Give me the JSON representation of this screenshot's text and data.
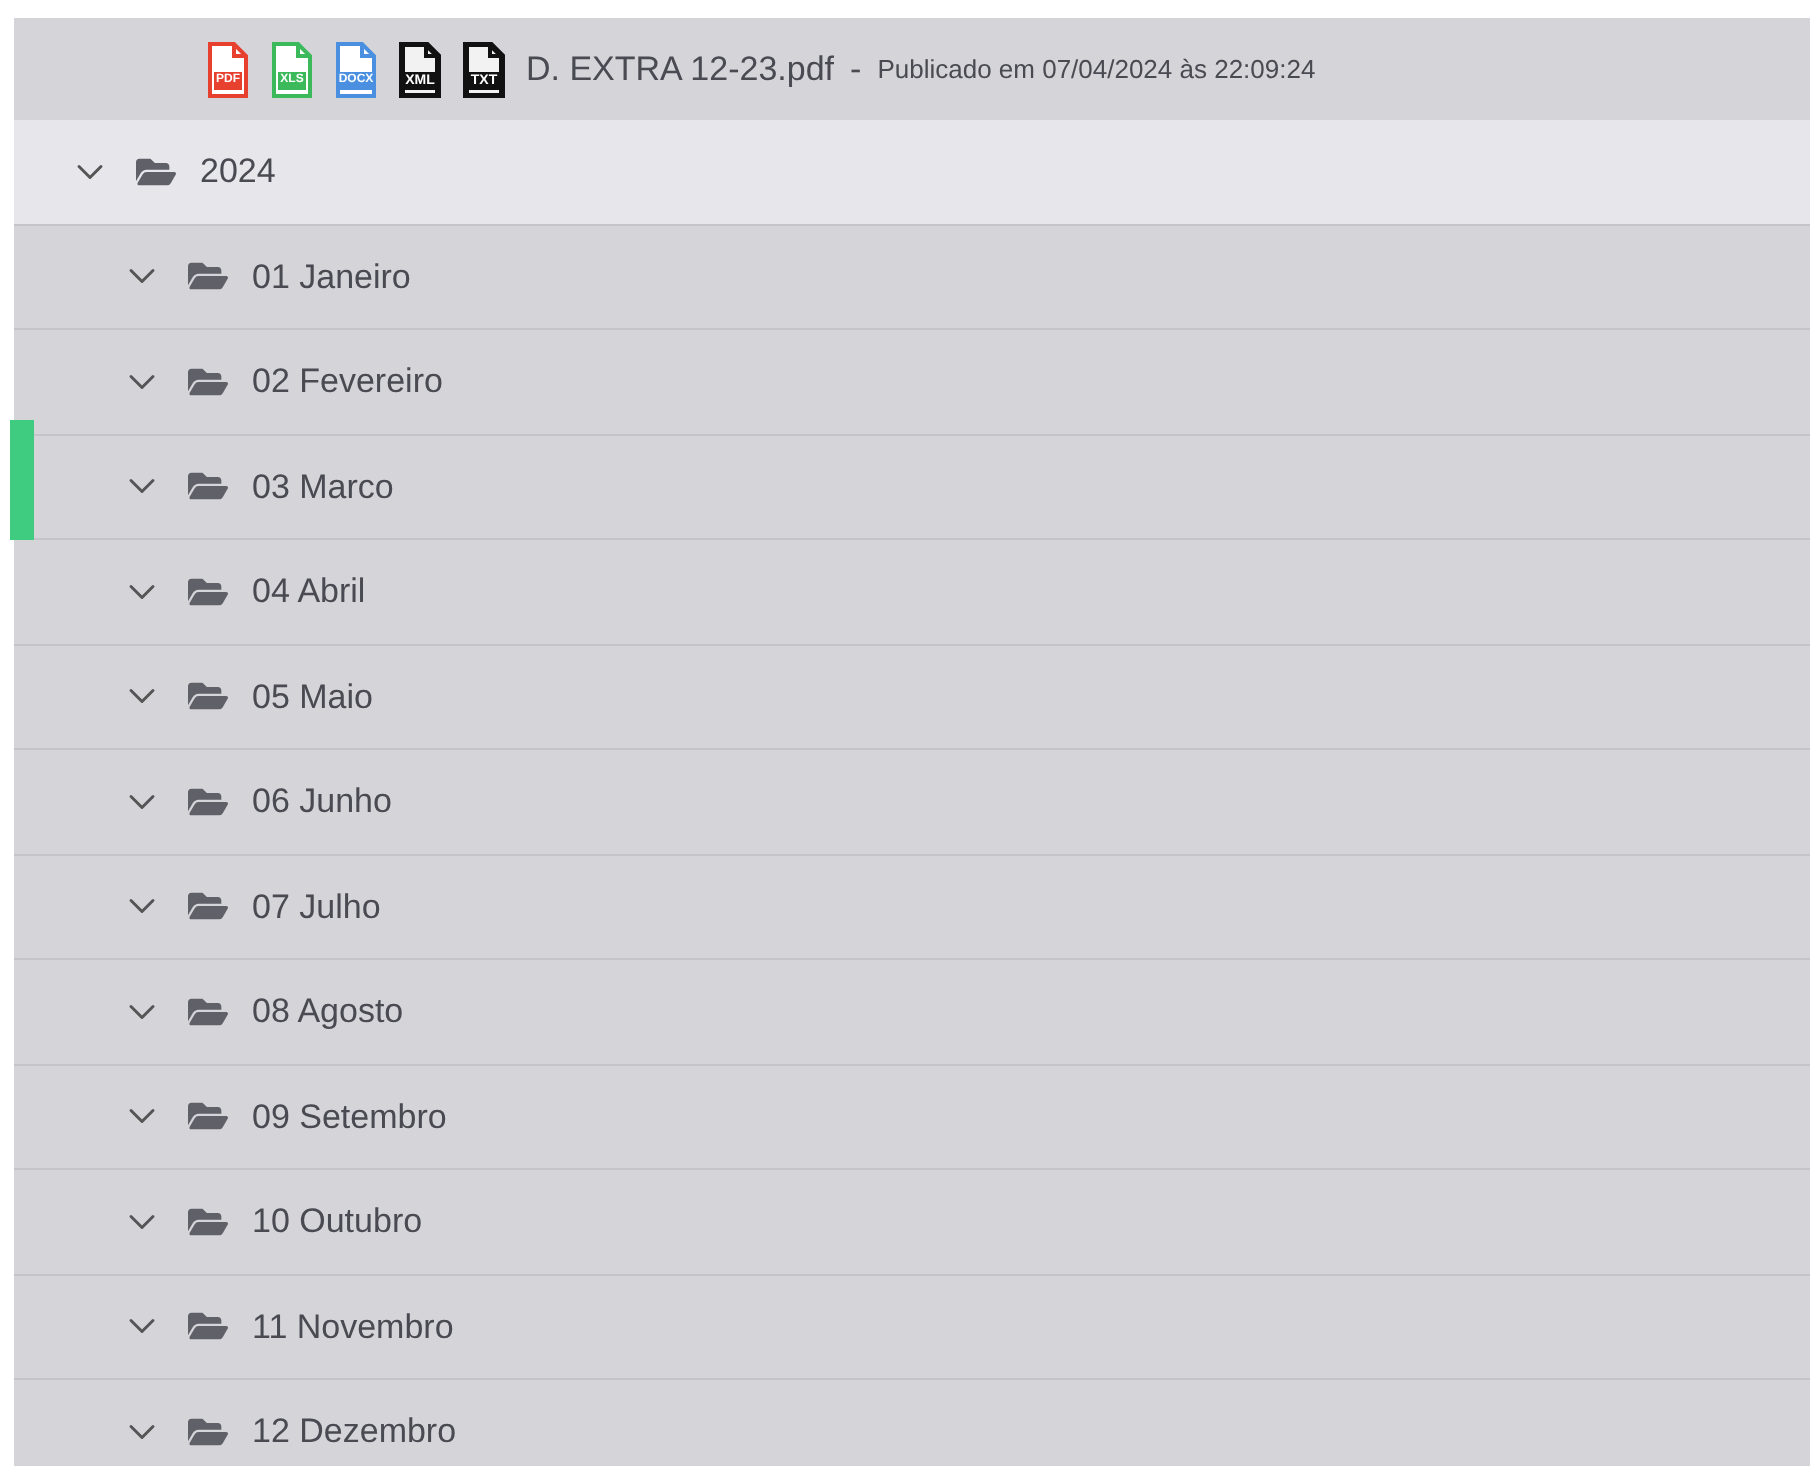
{
  "document": {
    "files": [
      {
        "label": "PDF",
        "color": "#e8402f",
        "kind": "outline"
      },
      {
        "label": "XLS",
        "color": "#3cb95a",
        "kind": "outline"
      },
      {
        "label": "DOCX",
        "color": "#4a8fe0",
        "kind": "outline"
      },
      {
        "label": "XML",
        "color": "#111111",
        "kind": "solid"
      },
      {
        "label": "TXT",
        "color": "#111111",
        "kind": "solid"
      }
    ],
    "name": "D. EXTRA 12-23.pdf",
    "separator": "-",
    "published": "Publicado em 07/04/2024 às 22:09:24"
  },
  "year": {
    "label": "2024",
    "expanded": true,
    "children": [
      {
        "label": "01 Janeiro",
        "expanded": true,
        "marked": false
      },
      {
        "label": "02 Fevereiro",
        "expanded": true,
        "marked": false
      },
      {
        "label": "03 Marco",
        "expanded": true,
        "marked": true
      },
      {
        "label": "04 Abril",
        "expanded": true,
        "marked": false
      },
      {
        "label": "05 Maio",
        "expanded": true,
        "marked": false
      },
      {
        "label": "06 Junho",
        "expanded": true,
        "marked": false
      },
      {
        "label": "07 Julho",
        "expanded": true,
        "marked": false
      },
      {
        "label": "08 Agosto",
        "expanded": true,
        "marked": false
      },
      {
        "label": "09 Setembro",
        "expanded": true,
        "marked": false
      },
      {
        "label": "10 Outubro",
        "expanded": true,
        "marked": false
      },
      {
        "label": "11 Novembro",
        "expanded": true,
        "marked": false
      },
      {
        "label": "12 Dezembro",
        "expanded": true,
        "marked": false
      }
    ]
  }
}
